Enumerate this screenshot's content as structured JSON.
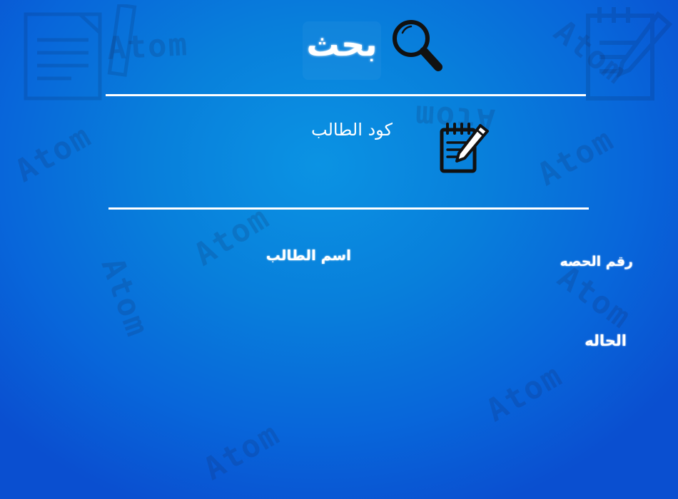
{
  "header": {
    "title": "بحث",
    "search_icon": "magnifier-icon",
    "code_icon": "notepad-pencil-icon"
  },
  "form": {
    "student_code": {
      "value": "",
      "placeholder": "كود الطالب"
    }
  },
  "labels": {
    "student_name": "اسم الطالب",
    "session_number": "رقم الحصه",
    "status": "الحاله"
  },
  "background": {
    "watermark_text": "Atom",
    "watermark_icons": [
      "document-icon",
      "notepad-pencil-icon"
    ],
    "colors": {
      "center": "#0b93e3",
      "edge": "#0a4fd0",
      "text": "#ffffff",
      "icon": "#111111"
    }
  }
}
